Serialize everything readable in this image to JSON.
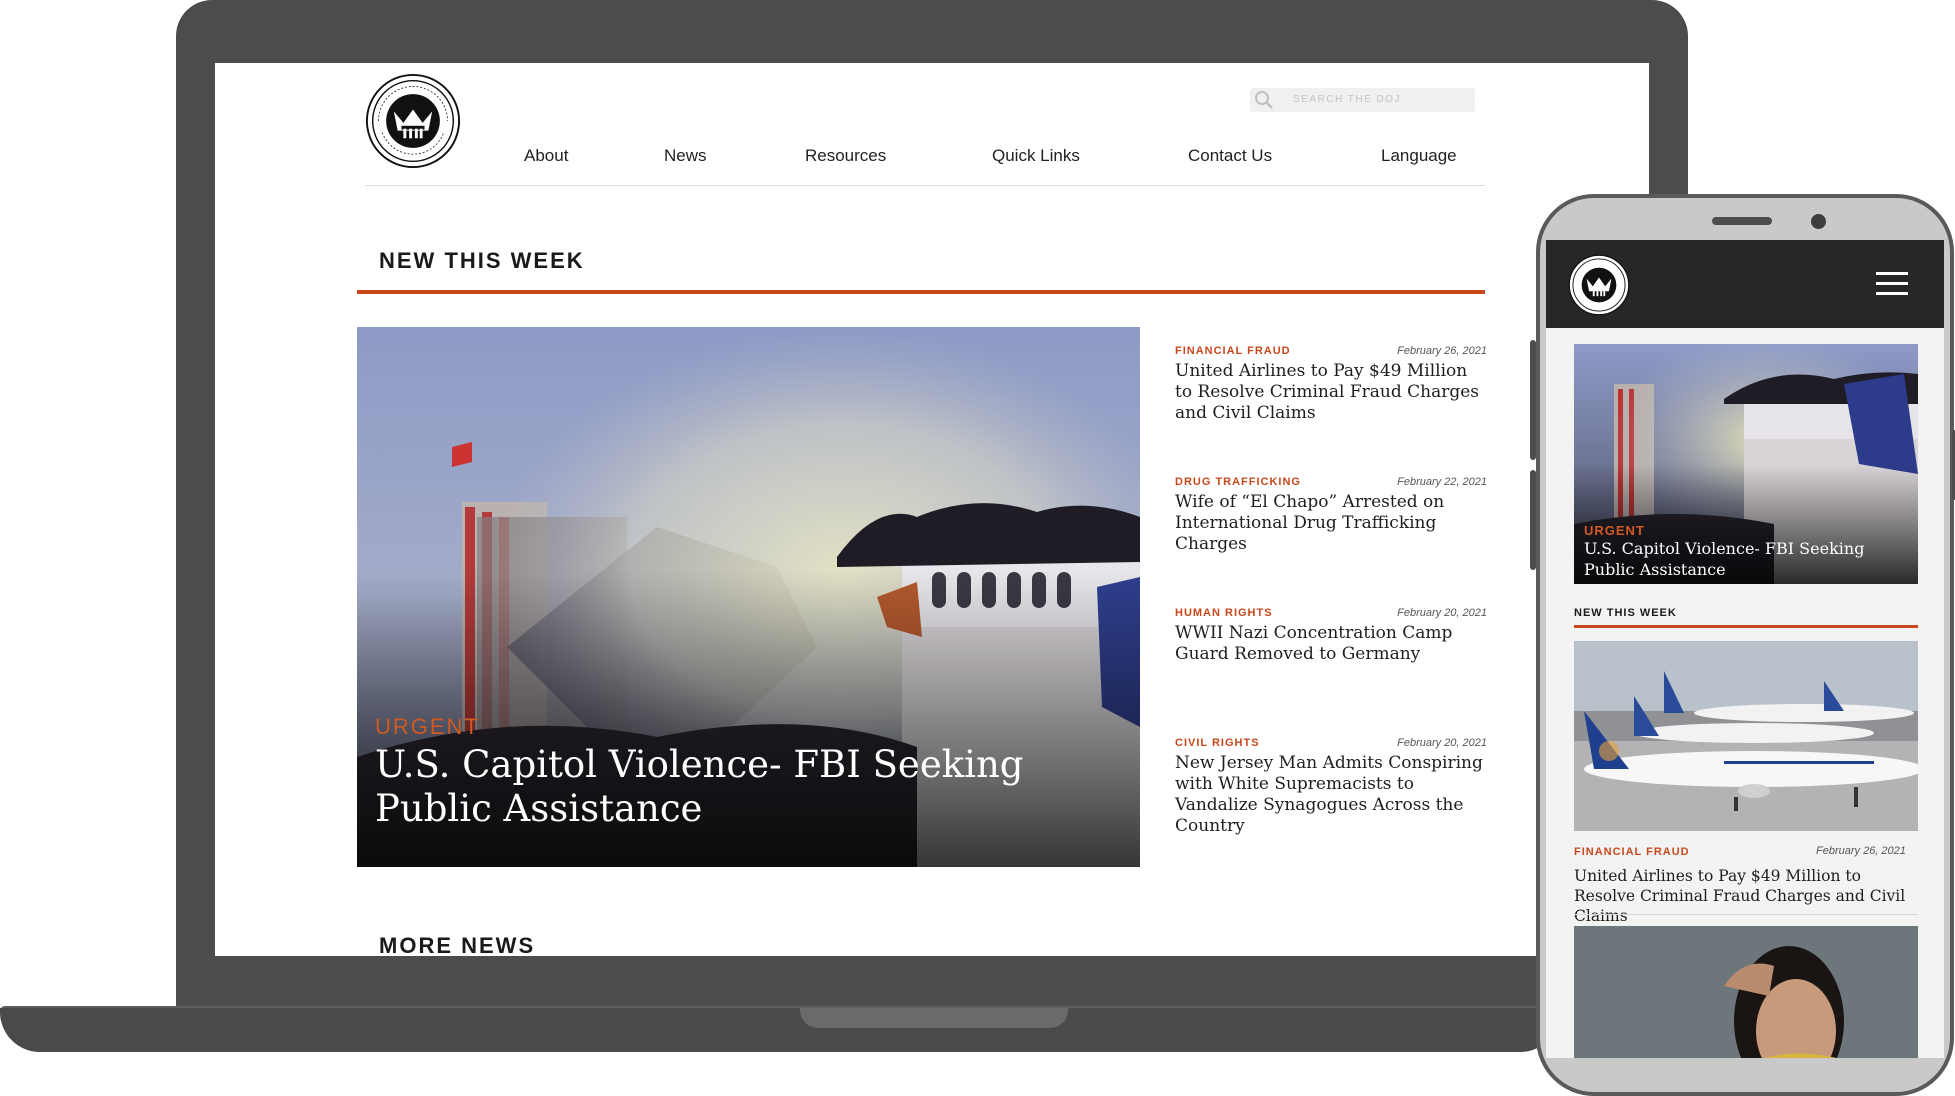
{
  "desktop": {
    "search": {
      "placeholder": "SEARCH THE DOJ"
    },
    "nav": [
      {
        "label": "About"
      },
      {
        "label": "News"
      },
      {
        "label": "Resources"
      },
      {
        "label": "Quick Links"
      },
      {
        "label": "Contact Us"
      },
      {
        "label": "Language"
      }
    ],
    "section_title": "NEW THIS WEEK",
    "hero": {
      "tag": "URGENT",
      "title": "U.S. Capitol Violence- FBI Seeking Public Assistance"
    },
    "articles": [
      {
        "category": "FINANCIAL FRAUD",
        "date": "February 26, 2021",
        "title": "United Airlines to Pay $49 Million to Resolve Criminal Fraud Charges and Civil Claims"
      },
      {
        "category": "DRUG TRAFFICKING",
        "date": "February 22, 2021",
        "title": "Wife of “El Chapo” Arrested on International Drug Trafficking Charges"
      },
      {
        "category": "HUMAN RIGHTS",
        "date": "February 20, 2021",
        "title": "WWII Nazi Concentration Camp Guard Removed to Germany"
      },
      {
        "category": "CIVIL RIGHTS",
        "date": "February 20, 2021",
        "title": "New Jersey Man Admits Conspiring with White Supremacists to Vandalize Synagogues Across the Country"
      }
    ],
    "more_title": "MORE NEWS"
  },
  "mobile": {
    "hero": {
      "tag": "URGENT",
      "title": "U.S. Capitol Violence- FBI Seeking Public Assistance"
    },
    "section_title": "NEW THIS WEEK",
    "article": {
      "category": "FINANCIAL FRAUD",
      "date": "February 26, 2021",
      "title": "United Airlines to Pay $49 Million to Resolve Criminal Fraud Charges and Civil Claims"
    }
  },
  "icons": {
    "seal": "doj-seal-icon",
    "search": "search-icon",
    "menu": "hamburger-menu-icon"
  },
  "colors": {
    "accent": "#c8481c",
    "device_frame": "#4c4c4c",
    "mobile_header": "#272727"
  }
}
